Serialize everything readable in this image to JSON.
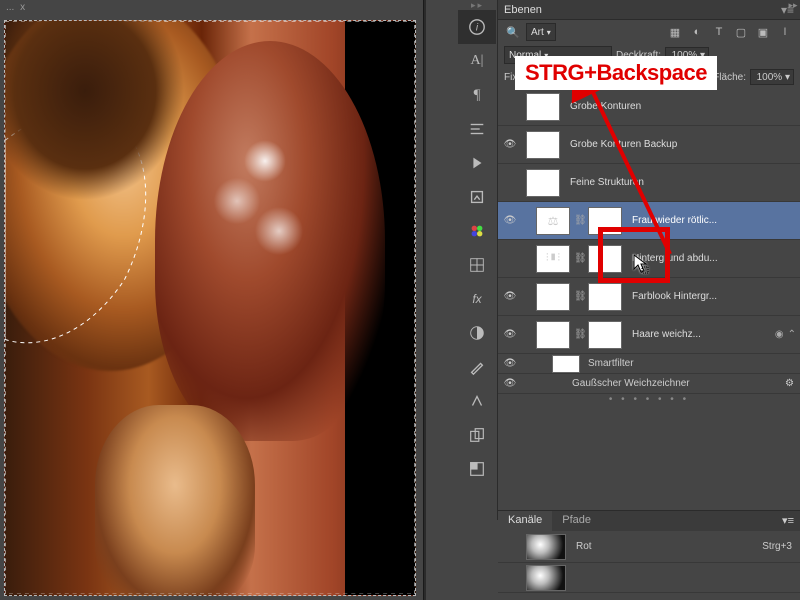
{
  "document": {
    "tab_label": "...",
    "tab_close": "x"
  },
  "iconbar": {
    "items": [
      {
        "name": "info-icon",
        "glyph": "i"
      },
      {
        "name": "character-icon",
        "glyph": "A"
      },
      {
        "name": "paragraph-icon",
        "glyph": "¶"
      },
      {
        "name": "align-icon",
        "glyph": "≡"
      },
      {
        "name": "actions-icon",
        "glyph": "▶"
      },
      {
        "name": "history-icon",
        "glyph": "↶"
      },
      {
        "name": "swatches-icon",
        "glyph": "▦"
      },
      {
        "name": "color-icon",
        "glyph": "◑"
      },
      {
        "name": "styles-icon",
        "glyph": "fx"
      },
      {
        "name": "adjust-icon",
        "glyph": "◧"
      },
      {
        "name": "brushes-icon",
        "glyph": "✎"
      },
      {
        "name": "brush-presets-icon",
        "glyph": "✦"
      },
      {
        "name": "clone-icon",
        "glyph": "▣"
      },
      {
        "name": "navigator-icon",
        "glyph": "◱"
      }
    ]
  },
  "layers_panel": {
    "title": "Ebenen",
    "filter_label": "Art",
    "blend_mode": "Normal",
    "opacity_label": "Deckkraft:",
    "opacity_value": "100%",
    "lock_label": "Fixieren:",
    "fill_label": "Fläche:",
    "fill_value": "100%",
    "layers": [
      {
        "name": "Grobe Konturen",
        "visible": false,
        "kind": "checker"
      },
      {
        "name": "Grobe Konturen Backup",
        "visible": true,
        "kind": "checker"
      },
      {
        "name": "Feine Strukturen",
        "visible": false,
        "kind": "smoke"
      },
      {
        "name": "Frau wieder rötlic...",
        "visible": true,
        "kind": "balance",
        "mask": "white",
        "selected": true
      },
      {
        "name": "Hintergrund abdu...",
        "visible": false,
        "kind": "levels",
        "mask": "shape"
      },
      {
        "name": "Farblook Hintergr...",
        "visible": true,
        "kind": "blue",
        "mask": "shape"
      },
      {
        "name": "Haare weichz...",
        "visible": true,
        "kind": "photo",
        "mask": "shape",
        "smart": true
      }
    ],
    "smartfilter_label": "Smartfilter",
    "smartfilter_item": "Gaußscher Weichzeichner"
  },
  "channels_panel": {
    "tab_channels": "Kanäle",
    "tab_paths": "Pfade",
    "channels": [
      {
        "name": "Rot",
        "shortcut": "Strg+3"
      }
    ]
  },
  "annotation": {
    "label": "STRG+Backspace"
  }
}
